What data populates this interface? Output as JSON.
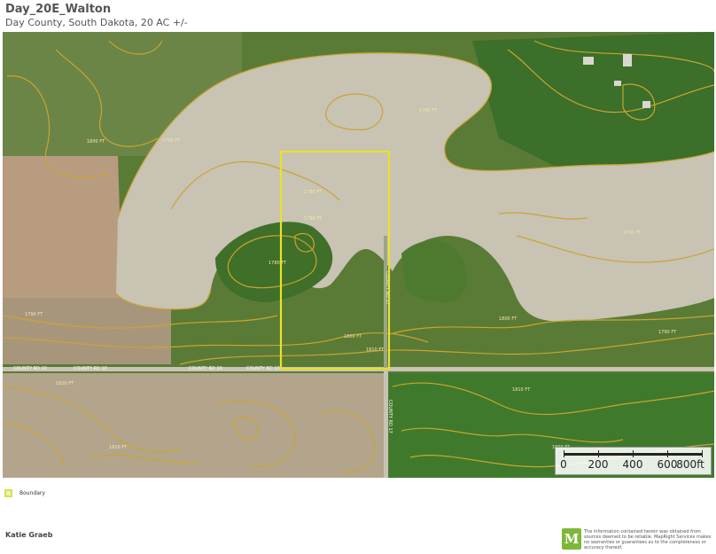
{
  "header": {
    "title": "Day_20E_Walton",
    "subtitle": "Day County, South Dakota, 20 AC +/-"
  },
  "map": {
    "contour_labels": [
      "1790 FT",
      "1790 FT",
      "1790 FT",
      "1790 FT",
      "1790 FT",
      "1800 FT",
      "1800 FT",
      "1800 FT",
      "1810 FT",
      "1810 FT",
      "1820 FT",
      "1780 FT",
      "1780 FT",
      "1790 FT",
      "1800 FT",
      "1810 FT"
    ],
    "road_labels": [
      "COUNTY RD 10",
      "COUNTY RD 10",
      "COUNTY RD 10",
      "COUNTY RD 10",
      "COUNTY RD 17",
      "COUNTY RD 17"
    ],
    "colors": {
      "boundary": "#e8e227",
      "contour": "#c9a531",
      "water": "#c9c4b3",
      "grass": "#4f7d2f",
      "field": "#b8a88f",
      "road": "#c8c3b4"
    },
    "scalebar": {
      "labels": [
        "0",
        "200",
        "400",
        "600",
        "800ft"
      ]
    }
  },
  "legend": {
    "boundary_label": "Boundary",
    "swatch_icon": "boundary-swatch-icon"
  },
  "footer": {
    "agent": "Katie Graeb",
    "logo_letter": "M",
    "disclaimer": "The information contained herein was obtained from sources deemed to be reliable. MapRight Services makes no warranties or guarantees as to the completeness or accuracy thereof."
  }
}
